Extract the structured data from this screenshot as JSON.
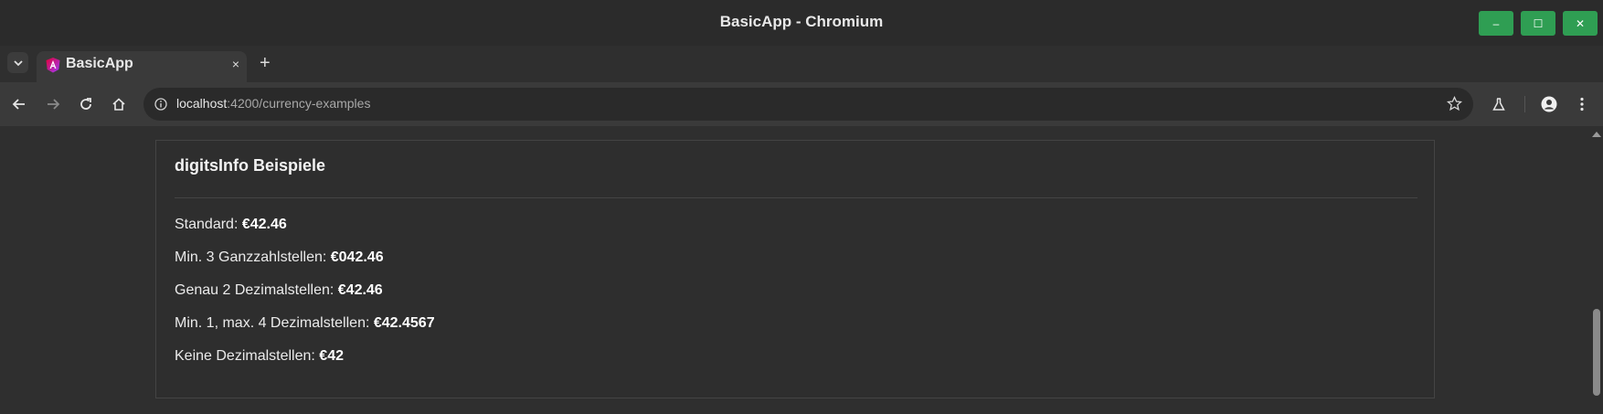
{
  "window": {
    "title": "BasicApp - Chromium",
    "controls": {
      "minimize": "–",
      "maximize": "☐",
      "close": "✕"
    },
    "control_color": "#2f9e53"
  },
  "tabs": [
    {
      "title": "BasicApp",
      "favicon": "angular-logo-icon",
      "close_symbol": "×"
    }
  ],
  "new_tab_symbol": "+",
  "toolbar": {
    "back_icon": "arrow-left-icon",
    "forward_icon": "arrow-right-icon",
    "reload_icon": "reload-icon",
    "home_icon": "home-icon",
    "site_info_icon": "info-icon",
    "bookmark_icon": "star-icon",
    "labs_icon": "flask-icon",
    "profile_icon": "profile-icon",
    "menu_icon": "kebab-menu-icon"
  },
  "address_bar": {
    "host": "localhost",
    "path": ":4200/currency-examples"
  },
  "card": {
    "title": "digitsInfo Beispiele",
    "examples": [
      {
        "label": "Standard: ",
        "value": "€42.46"
      },
      {
        "label": "Min. 3 Ganzzahlstellen: ",
        "value": "€042.46"
      },
      {
        "label": "Genau 2 Dezimalstellen: ",
        "value": "€42.46"
      },
      {
        "label": "Min. 1, max. 4 Dezimalstellen: ",
        "value": "€42.4567"
      },
      {
        "label": "Keine Dezimalstellen: ",
        "value": "€42"
      }
    ]
  }
}
